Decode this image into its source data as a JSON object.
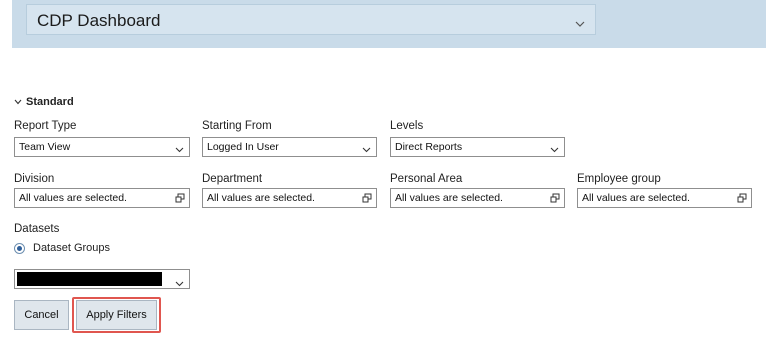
{
  "header": {
    "view_title": "CDP Dashboard",
    "chevron_icon": "chevron-down-icon"
  },
  "section": {
    "title": "Standard",
    "toggle_icon": "chevron-down-icon"
  },
  "filters": {
    "report_type": {
      "label": "Report Type",
      "value": "Team View"
    },
    "starting_from": {
      "label": "Starting From",
      "value": "Logged In User"
    },
    "levels": {
      "label": "Levels",
      "value": "Direct Reports"
    },
    "division": {
      "label": "Division",
      "value": "All values are selected."
    },
    "department": {
      "label": "Department",
      "value": "All values are selected."
    },
    "personal_area": {
      "label": "Personal Area",
      "value": "All values are selected."
    },
    "employee_group": {
      "label": "Employee group",
      "value": "All values are selected."
    }
  },
  "datasets": {
    "label": "Datasets",
    "radio_label": "Dataset Groups",
    "radio_selected": true
  },
  "buttons": {
    "cancel": "Cancel",
    "apply": "Apply Filters",
    "apply_highlight_color": "#e0564f"
  }
}
